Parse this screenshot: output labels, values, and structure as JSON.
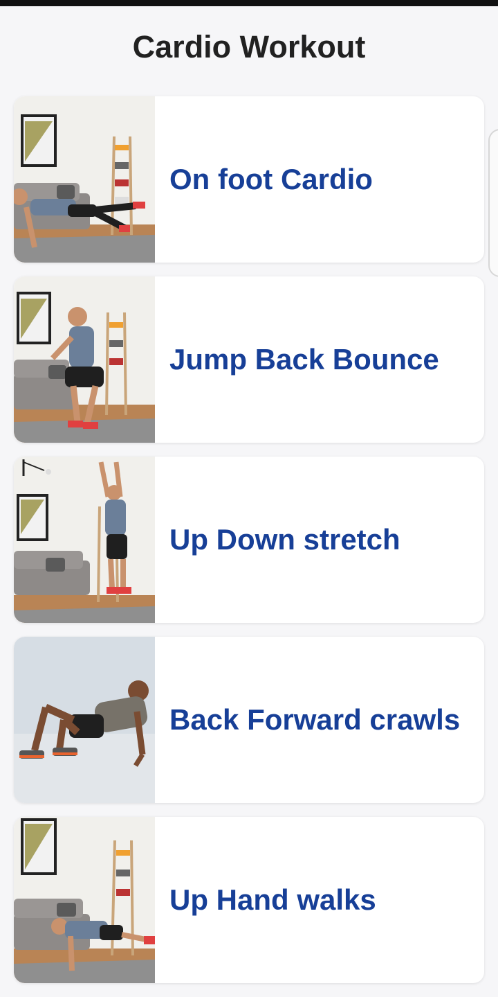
{
  "header": {
    "title": "Cardio Workout"
  },
  "colors": {
    "title": "#212121",
    "card_label": "#173f97",
    "background": "#f6f6f8",
    "card": "#ffffff"
  },
  "workouts": [
    {
      "label": "On foot Cardio",
      "image_icon": "exercise-photo-plank-kick-icon"
    },
    {
      "label": "Jump Back Bounce",
      "image_icon": "exercise-photo-squat-jump-icon"
    },
    {
      "label": "Up Down stretch",
      "image_icon": "exercise-photo-jump-reach-icon"
    },
    {
      "label": "Back Forward crawls",
      "image_icon": "exercise-photo-crab-walk-icon"
    },
    {
      "label": "Up Hand walks",
      "image_icon": "exercise-photo-hand-walk-icon"
    }
  ]
}
